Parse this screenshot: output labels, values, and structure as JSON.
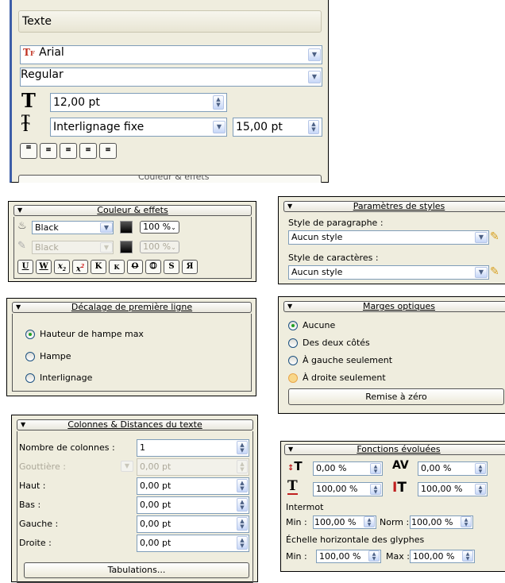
{
  "texte": {
    "title": "Texte",
    "font": "Arial",
    "style": "Regular",
    "size": "12,00 pt",
    "spacing_mode": "Interlignage fixe",
    "spacing_value": "15,00 pt",
    "cutoff_label": "Couleur & effets"
  },
  "couleur": {
    "title": "Couleur & effets",
    "fill_color": "Black",
    "fill_pct": "100 %",
    "stroke_color": "Black",
    "stroke_pct": "100 %",
    "buttons": [
      "U",
      "W",
      "x",
      "x",
      "K",
      "K",
      "O",
      "O",
      "S",
      "Я"
    ]
  },
  "params": {
    "title": "Paramètres de styles",
    "para_label": "Style de paragraphe :",
    "para_value": "Aucun style",
    "char_label": "Style de caractères :",
    "char_value": "Aucun style"
  },
  "decalage": {
    "title": "Décalage de première ligne",
    "options": [
      "Hauteur de hampe max",
      "Hampe",
      "Interlignage"
    ],
    "selected": 0
  },
  "marges": {
    "title": "Marges optiques",
    "options": [
      "Aucune",
      "Des deux côtés",
      "À gauche seulement",
      "À droite seulement"
    ],
    "selected": 0,
    "hover": 3,
    "reset": "Remise à zéro"
  },
  "colonnes": {
    "title": "Colonnes & Distances du texte",
    "rows": [
      {
        "label": "Nombre de colonnes :",
        "value": "1"
      },
      {
        "label": "Gouttière :",
        "value": "0,00 pt"
      },
      {
        "label": "Haut :",
        "value": "0,00 pt"
      },
      {
        "label": "Bas :",
        "value": "0,00 pt"
      },
      {
        "label": "Gauche :",
        "value": "0,00 pt"
      },
      {
        "label": "Droite :",
        "value": "0,00 pt"
      }
    ],
    "tabs_button": "Tabulations..."
  },
  "fonctions": {
    "title": "Fonctions évoluées",
    "baseline": "0,00 %",
    "tracking": "0,00 %",
    "hscale": "100,00 %",
    "vscale": "100,00 %",
    "intermot": "Intermot",
    "min_label": "Min :",
    "norm_label": "Norm :",
    "max_label": "Max :",
    "word_min": "100,00 %",
    "word_norm": "100,00 %",
    "glyph_label": "Échelle horizontale des glyphes",
    "glyph_min": "100,00 %",
    "glyph_max": "100,00 %"
  }
}
